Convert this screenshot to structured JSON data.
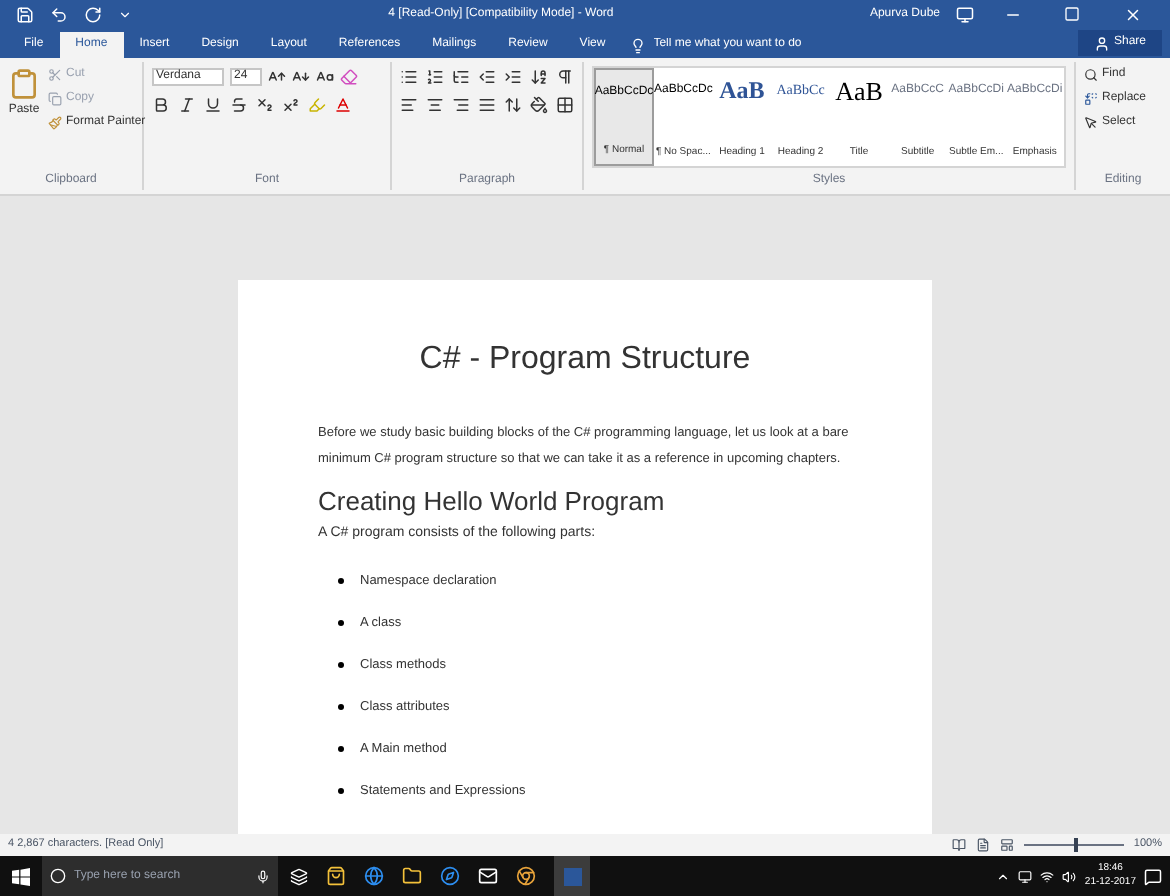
{
  "window": {
    "title": "4 [Read-Only] [Compatibility Mode] - Word",
    "user": "Apurva Dube"
  },
  "tabs": [
    {
      "label": "File",
      "selected": false
    },
    {
      "label": "Home",
      "selected": true
    },
    {
      "label": "Insert",
      "selected": false
    },
    {
      "label": "Design",
      "selected": false
    },
    {
      "label": "Layout",
      "selected": false
    },
    {
      "label": "References",
      "selected": false
    },
    {
      "label": "Mailings",
      "selected": false
    },
    {
      "label": "Review",
      "selected": false
    },
    {
      "label": "View",
      "selected": false
    }
  ],
  "tell_me": {
    "placeholder": "Tell me what you want to do"
  },
  "share": "Share",
  "clipboard": {
    "paste": "Paste",
    "cut": "Cut",
    "copy": "Copy",
    "format_painter": "Format Painter",
    "label": "Clipboard"
  },
  "font": {
    "name": "Verdana",
    "size": "24",
    "label": "Font"
  },
  "paragraph": {
    "label": "Paragraph"
  },
  "styles": {
    "label": "Styles",
    "items": [
      {
        "preview": "AaBbCcDc",
        "name": "¶ Normal",
        "kind": "normal",
        "selected": true
      },
      {
        "preview": "AaBbCcDc",
        "name": "¶ No Spac...",
        "kind": "normal",
        "selected": false
      },
      {
        "preview": "AaB",
        "name": "Heading 1",
        "kind": "heading1",
        "selected": false
      },
      {
        "preview": "AaBbCc",
        "name": "Heading 2",
        "kind": "heading2",
        "selected": false
      },
      {
        "preview": "AaB",
        "name": "Title",
        "kind": "title",
        "selected": false
      },
      {
        "preview": "AaBbCcC",
        "name": "Subtitle",
        "kind": "subtle",
        "selected": false
      },
      {
        "preview": "AaBbCcDi",
        "name": "Subtle Em...",
        "kind": "subtle",
        "selected": false
      },
      {
        "preview": "AaBbCcDi",
        "name": "Emphasis",
        "kind": "subtle",
        "selected": false
      }
    ]
  },
  "editing": {
    "find": "Find",
    "replace": "Replace",
    "select": "Select",
    "label": "Editing"
  },
  "document": {
    "title": "C# - Program Structure",
    "intro": "Before we study basic building blocks of the C# programming language, let us look at a bare minimum C# program structure so that we can take it as a reference in upcoming chapters.",
    "heading": "Creating Hello World Program",
    "lead": "A C# program consists of the following parts:",
    "bullets": [
      "Namespace declaration",
      "A class",
      "Class methods",
      "Class attributes",
      "A Main method",
      "Statements and Expressions"
    ]
  },
  "status_bar": {
    "text": "4 2,867 characters. [Read Only]",
    "zoom": "100%",
    "zoom_slider": {
      "level": 0.5
    }
  },
  "taskbar": {
    "search": {
      "placeholder": "Type here to search"
    },
    "time": "18:46",
    "date": "21-12-2017"
  }
}
